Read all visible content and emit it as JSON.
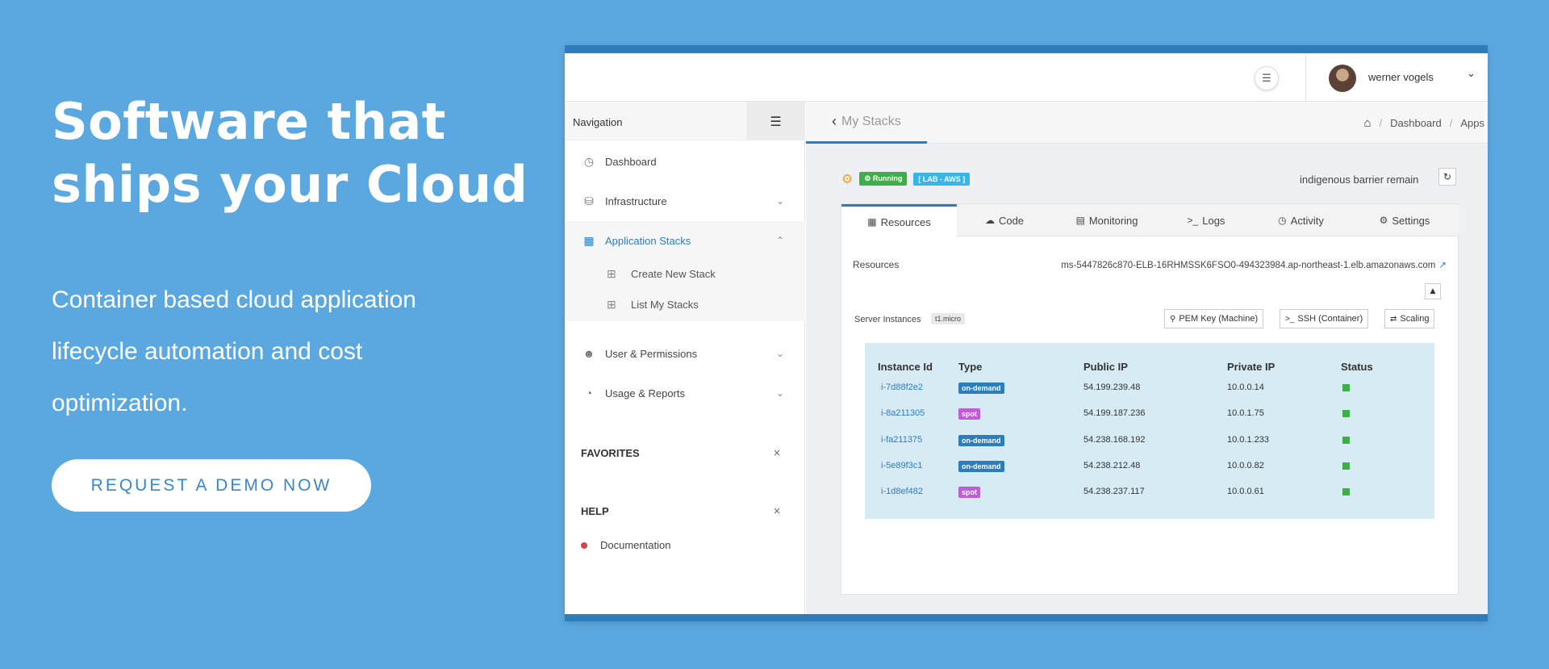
{
  "hero": {
    "title_line1": "Software that",
    "title_line2": "ships your Cloud",
    "sub_line1": "Container based cloud application",
    "sub_line2": "lifecycle automation and cost",
    "sub_line3": "optimization.",
    "cta": "REQUEST A DEMO NOW"
  },
  "topbar": {
    "user_name": "werner vogels",
    "menu_icon": "list-icon",
    "caret_icon": "chevron-down-icon"
  },
  "sidebar": {
    "header": "Navigation",
    "items": [
      {
        "label": "Dashboard",
        "icon": "gauge-icon"
      },
      {
        "label": "Infrastructure",
        "icon": "database-icon"
      },
      {
        "label": "Application Stacks",
        "icon": "grid-icon"
      },
      {
        "label": "User & Permissions",
        "icon": "user-icon"
      },
      {
        "label": "Usage & Reports",
        "icon": "pie-icon"
      }
    ],
    "sub_items": [
      {
        "label": "Create New Stack",
        "icon": "grid-plus-icon"
      },
      {
        "label": "List My Stacks",
        "icon": "grid-list-icon"
      }
    ],
    "favorites": "FAVORITES",
    "help": "HELP",
    "documentation": "Documentation"
  },
  "main": {
    "back_label": "My Stacks",
    "breadcrumb": [
      "Dashboard",
      "Apps"
    ],
    "status": "Running",
    "env": "[ LAB - AWS ]",
    "stack_name": "indigenous barrier remain",
    "tabs": [
      {
        "label": "Resources",
        "icon": "grid-icon"
      },
      {
        "label": "Code",
        "icon": "cloud-icon"
      },
      {
        "label": "Monitoring",
        "icon": "chart-icon"
      },
      {
        "label": "Logs",
        "icon": "terminal-icon"
      },
      {
        "label": "Activity",
        "icon": "clock-icon"
      },
      {
        "label": "Settings",
        "icon": "gear-icon"
      }
    ],
    "resources_label": "Resources",
    "resources_value": "ms-5447826c870-ELB-16RHMSSK6FSO0-494323984.ap-northeast-1.elb.amazonaws.com",
    "server_instances_label": "Server Instances",
    "instance_type": "t1.micro",
    "actions": [
      "PEM Key (Machine)",
      "SSH (Container)",
      "Scaling"
    ],
    "instances": {
      "columns": [
        "Instance Id",
        "Type",
        "Public IP",
        "Private IP",
        "Status"
      ],
      "rows": [
        {
          "id": "i-7d88f2e2",
          "type": "on-demand",
          "public_ip": "54.199.239.48",
          "private_ip": "10.0.0.14",
          "status": "running"
        },
        {
          "id": "i-8a211305",
          "type": "spot",
          "public_ip": "54.199.187.236",
          "private_ip": "10.0.1.75",
          "status": "running"
        },
        {
          "id": "i-fa211375",
          "type": "on-demand",
          "public_ip": "54.238.168.192",
          "private_ip": "10.0.1.233",
          "status": "running"
        },
        {
          "id": "i-5e89f3c1",
          "type": "on-demand",
          "public_ip": "54.238.212.48",
          "private_ip": "10.0.0.82",
          "status": "running"
        },
        {
          "id": "i-1d8ef482",
          "type": "spot",
          "public_ip": "54.238.237.117",
          "private_ip": "10.0.0.61",
          "status": "running"
        }
      ]
    }
  },
  "colors": {
    "background": "#5ba8e0",
    "accent": "#2c7dbc",
    "running": "#3fae4a",
    "spot": "#c05cd6",
    "table_bg": "#d7ebf5"
  }
}
